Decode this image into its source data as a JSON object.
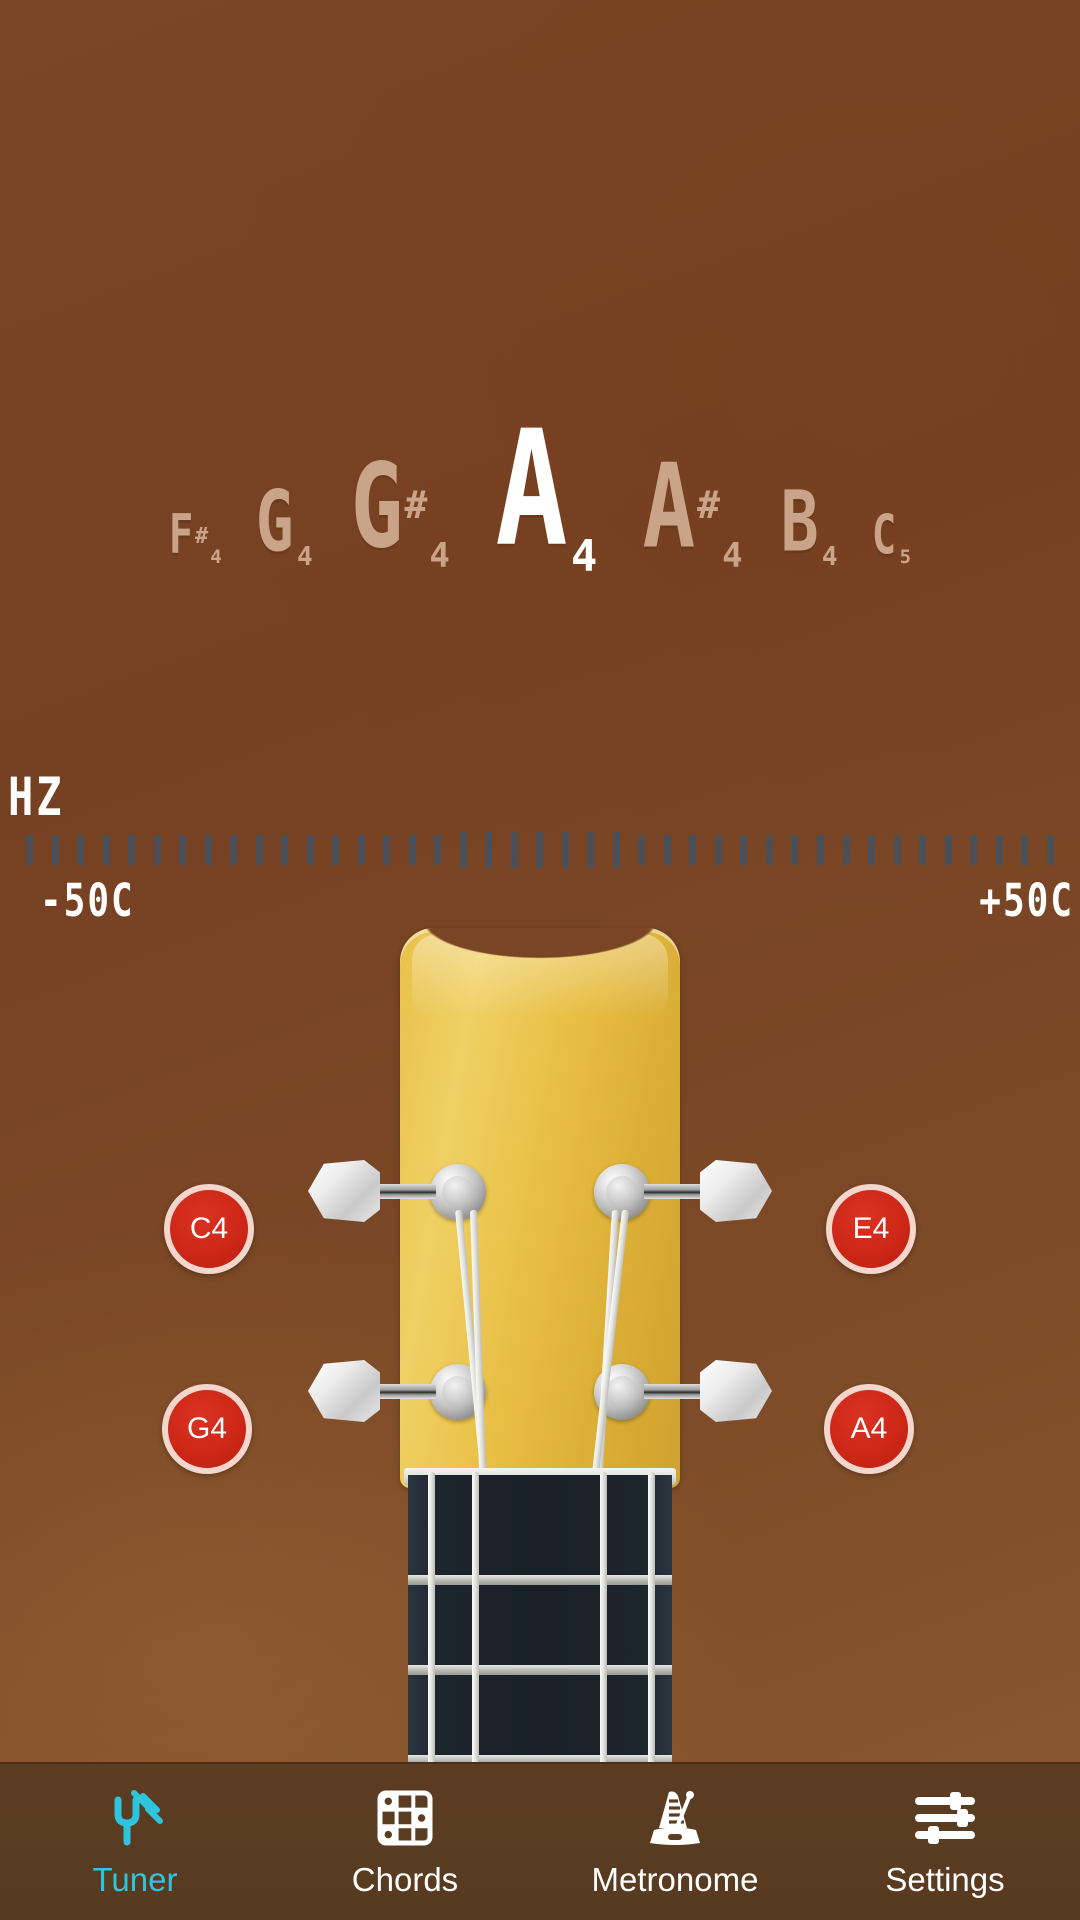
{
  "theme": {
    "background_brown": "#7a4524",
    "navbar_brown": "#5c3d22",
    "accent_cyan": "#2ec4dd",
    "string_button_red": "#ce2718",
    "headstock_yellow": "#e8c14a",
    "inactive_note": "#c9a489",
    "active_note": "#ffffff",
    "tick_gray": "#4b4f58"
  },
  "tuner": {
    "hz_label": "HZ",
    "cents_left": "-50C",
    "cents_right": "+50C",
    "tick_count": 41,
    "notes": [
      {
        "letter": "F",
        "sharp": "#",
        "octave": "4",
        "active": false,
        "distance": 3
      },
      {
        "letter": "G",
        "sharp": "",
        "octave": "4",
        "active": false,
        "distance": 2
      },
      {
        "letter": "G",
        "sharp": "#",
        "octave": "4",
        "active": false,
        "distance": 1
      },
      {
        "letter": "A",
        "sharp": "",
        "octave": "4",
        "active": true,
        "distance": 0
      },
      {
        "letter": "A",
        "sharp": "#",
        "octave": "4",
        "active": false,
        "distance": 1
      },
      {
        "letter": "B",
        "sharp": "",
        "octave": "4",
        "active": false,
        "distance": 2
      },
      {
        "letter": "C",
        "sharp": "",
        "octave": "5",
        "active": false,
        "distance": 3
      }
    ],
    "current_note": "A4"
  },
  "instrument": {
    "type": "ukulele",
    "strings": [
      {
        "id": "string-c4",
        "label": "C4",
        "side": "left",
        "row": "top"
      },
      {
        "id": "string-e4",
        "label": "E4",
        "side": "right",
        "row": "top"
      },
      {
        "id": "string-g4",
        "label": "G4",
        "side": "left",
        "row": "bottom"
      },
      {
        "id": "string-a4",
        "label": "A4",
        "side": "right",
        "row": "bottom"
      }
    ]
  },
  "navbar": {
    "items": [
      {
        "id": "tuner",
        "label": "Tuner",
        "icon": "tuning-fork-icon",
        "active": true
      },
      {
        "id": "chords",
        "label": "Chords",
        "icon": "chord-grid-icon",
        "active": false
      },
      {
        "id": "metronome",
        "label": "Metronome",
        "icon": "metronome-icon",
        "active": false
      },
      {
        "id": "settings",
        "label": "Settings",
        "icon": "sliders-icon",
        "active": false
      }
    ]
  }
}
